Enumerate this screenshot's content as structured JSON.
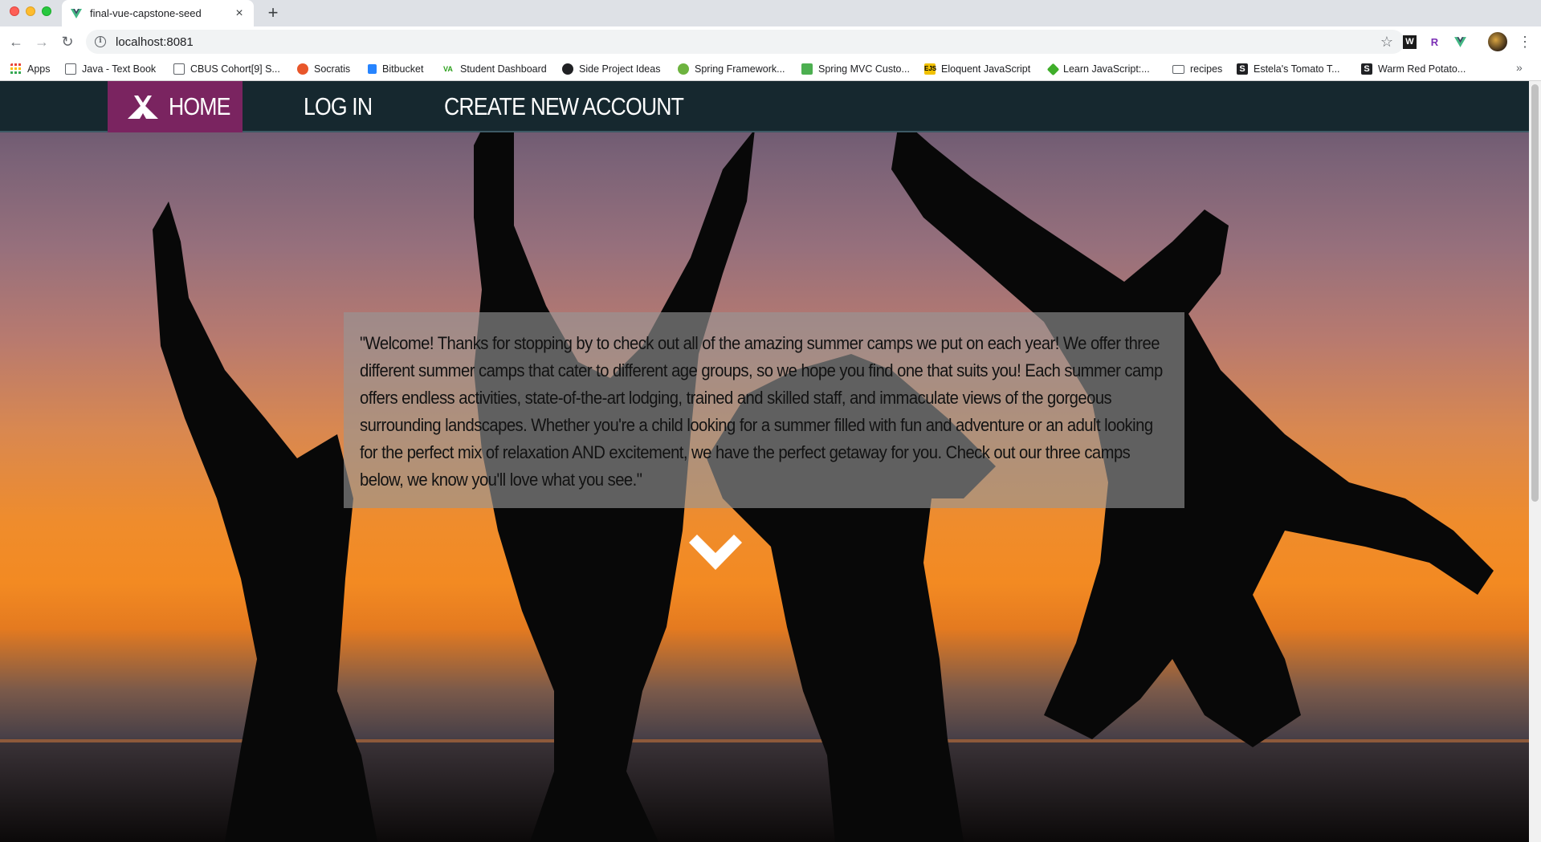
{
  "browser": {
    "tab_title": "final-vue-capstone-seed",
    "tab_close": "×",
    "new_tab": "+",
    "url": "localhost:8081",
    "bookmarks": [
      {
        "label": "Apps",
        "icon": "apps-grid-icon",
        "color": "#e94235"
      },
      {
        "label": "Java - Text Book",
        "icon": "book-icon",
        "color": "#5f6368"
      },
      {
        "label": "CBUS Cohort[9] S...",
        "icon": "trello-icon",
        "color": "#5f6368"
      },
      {
        "label": "Socratis",
        "icon": "socratis-icon",
        "color": "#e8562a"
      },
      {
        "label": "Bitbucket",
        "icon": "bitbucket-icon",
        "color": "#2684ff"
      },
      {
        "label": "Student Dashboard",
        "icon": "va-icon",
        "color": "#2ca01c"
      },
      {
        "label": "Side Project Ideas",
        "icon": "github-icon",
        "color": "#202124"
      },
      {
        "label": "Spring Framework...",
        "icon": "spring-icon",
        "color": "#6db33f"
      },
      {
        "label": "Spring MVC Custo...",
        "icon": "leaf-icon",
        "color": "#4caf50"
      },
      {
        "label": "Eloquent JavaScript",
        "icon": "ejs-icon",
        "color": "#f2c200"
      },
      {
        "label": "Learn JavaScript:...",
        "icon": "learn-js-icon",
        "color": "#3fae2a"
      },
      {
        "label": "recipes",
        "icon": "folder-icon",
        "color": "#5f6368"
      },
      {
        "label": "Estela's Tomato T...",
        "icon": "s-icon",
        "color": "#202124"
      },
      {
        "label": "Warm Red Potato...",
        "icon": "s-icon",
        "color": "#202124"
      }
    ],
    "bookmarks_more": "»"
  },
  "nav": {
    "home": "HOME",
    "login": "LOG IN",
    "create_account": "CREATE NEW ACCOUNT"
  },
  "welcome": {
    "text": "\"Welcome! Thanks for stopping by to check out all of the amazing summer camps we put on each year! We offer three different summer camps that cater to different age groups, so we hope you find one that suits you! Each summer camp offers endless activities, state-of-the-art lodging, trained and skilled staff, and immaculate views of the gorgeous surrounding landscapes. Whether you're a child looking for a summer filled with fun and adventure or an adult looking for the perfect mix of relaxation AND excitement, we have the perfect getaway for you. Check out our three camps below, we know you'll love what you see.\""
  },
  "colors": {
    "navbar": "#16282f",
    "home_active": "#7a2460",
    "welcome_overlay": "rgba(150,150,150,0.62)"
  }
}
